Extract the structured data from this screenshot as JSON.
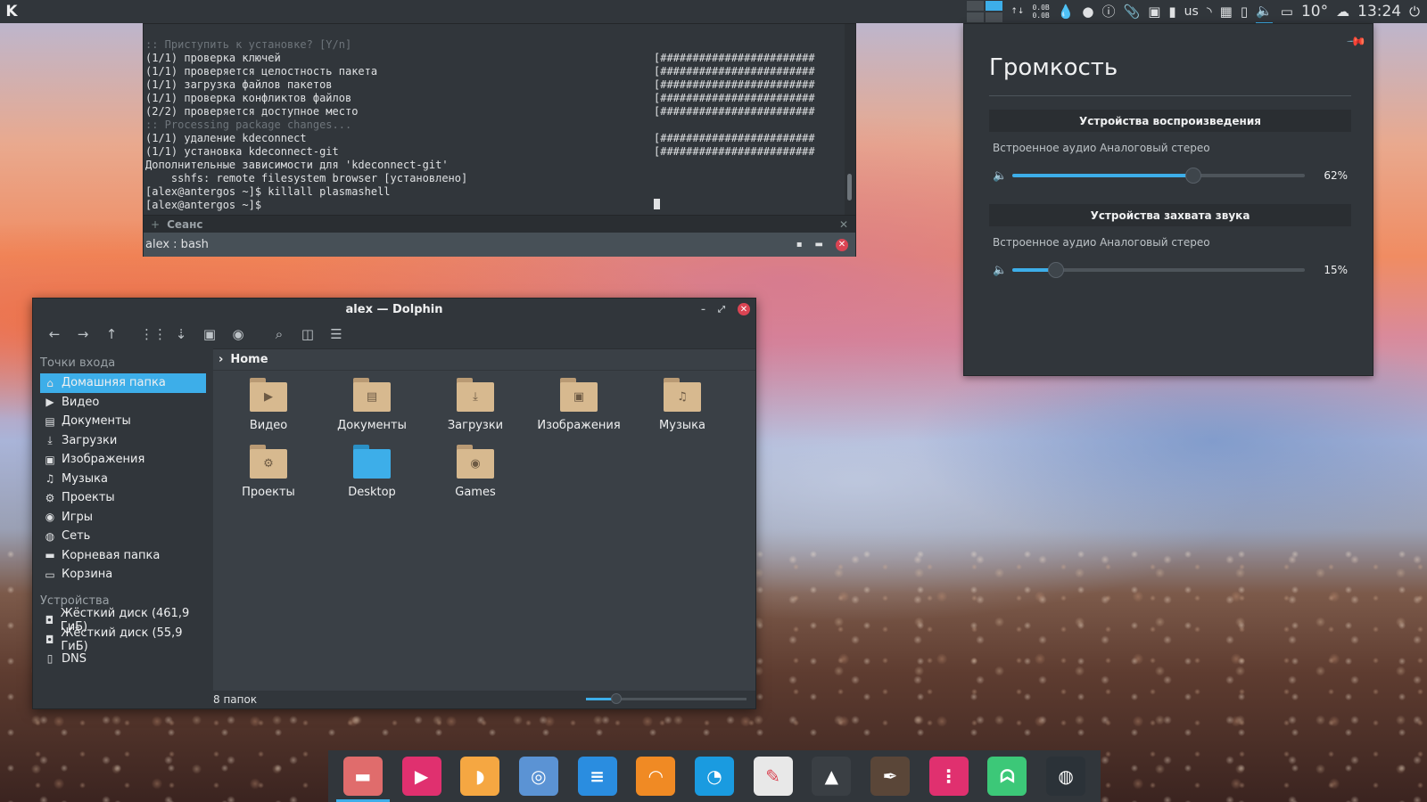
{
  "top_panel": {
    "logo": "K",
    "net_up": "0.0B",
    "net_down": "0.0B",
    "keyboard_layout": "us",
    "weather": "10°",
    "clock": "13:24",
    "icons": [
      "app-launcher-icon",
      "pager-icon",
      "network-speed-icon",
      "drop-icon",
      "record-icon",
      "info-icon",
      "paperclip-icon",
      "vault-icon",
      "usb-icon",
      "keyboard-layout-icon",
      "wifi-icon",
      "network-icon",
      "phone-icon",
      "volume-icon",
      "display-icon",
      "cloud-icon",
      "power-icon"
    ]
  },
  "terminal": {
    "lines": [
      {
        "left": ":: Приступить к установке? [Y/n]",
        "right": "",
        "dim": true
      },
      {
        "left": "(1/1) проверка ключей",
        "right": "[########################"
      },
      {
        "left": "(1/1) проверяется целостность пакета",
        "right": "[########################"
      },
      {
        "left": "(1/1) загрузка файлов пакетов",
        "right": "[########################"
      },
      {
        "left": "(1/1) проверка конфликтов файлов",
        "right": "[########################"
      },
      {
        "left": "(2/2) проверяется доступное место",
        "right": "[########################"
      },
      {
        "left": ":: Processing package changes...",
        "right": "",
        "dim": true
      },
      {
        "left": "(1/1) удаление kdeconnect",
        "right": "[########################"
      },
      {
        "left": "(1/1) установка kdeconnect-git",
        "right": "[########################"
      },
      {
        "left": "Дополнительные зависимости для 'kdeconnect-git'",
        "right": ""
      },
      {
        "left": "    sshfs: remote filesystem browser [установлено]",
        "right": ""
      },
      {
        "left": "[alex@antergos ~]$ killall plasmashell",
        "right": ""
      },
      {
        "left": "[alex@antergos ~]$ ",
        "right": ""
      }
    ],
    "tab_plus": "+",
    "tab_label": "Сеанс",
    "title": "alex : bash"
  },
  "volume": {
    "title": "Громкость",
    "playback_header": "Устройства воспроизведения",
    "playback_device": "Встроенное аудио Аналоговый стерео",
    "playback_level": 62,
    "playback_pct": "62%",
    "capture_header": "Устройства захвата звука",
    "capture_device": "Встроенное аудио Аналоговый стерео",
    "capture_level": 15,
    "capture_pct": "15%"
  },
  "dolphin": {
    "title": "alex — Dolphin",
    "places_header": "Точки входа",
    "places": [
      {
        "label": "Домашняя папка",
        "icon": "home-icon",
        "glyph": "⌂",
        "active": true
      },
      {
        "label": "Видео",
        "icon": "video-icon",
        "glyph": "▶"
      },
      {
        "label": "Документы",
        "icon": "document-icon",
        "glyph": "▤"
      },
      {
        "label": "Загрузки",
        "icon": "download-icon",
        "glyph": "⤓"
      },
      {
        "label": "Изображения",
        "icon": "image-icon",
        "glyph": "▣"
      },
      {
        "label": "Музыка",
        "icon": "music-icon",
        "glyph": "♫"
      },
      {
        "label": "Проекты",
        "icon": "gear-icon",
        "glyph": "⚙"
      },
      {
        "label": "Игры",
        "icon": "gamepad-icon",
        "glyph": "◉"
      },
      {
        "label": "Сеть",
        "icon": "network-icon",
        "glyph": "◍"
      },
      {
        "label": "Корневая папка",
        "icon": "folder-icon",
        "glyph": "▬"
      },
      {
        "label": "Корзина",
        "icon": "trash-icon",
        "glyph": "▭"
      }
    ],
    "devices_header": "Устройства",
    "devices": [
      {
        "label": "Жёсткий диск (461,9 ГиБ)",
        "icon": "harddisk-icon",
        "glyph": "◘"
      },
      {
        "label": "Жёсткий диск (55,9 ГиБ)",
        "icon": "harddisk-icon",
        "glyph": "◘"
      },
      {
        "label": "DNS",
        "icon": "usb-drive-icon",
        "glyph": "▯"
      }
    ],
    "breadcrumb": "Home",
    "folders": [
      {
        "label": "Видео",
        "icon": "folder-video-icon",
        "glyph": "▶"
      },
      {
        "label": "Документы",
        "icon": "folder-documents-icon",
        "glyph": "▤"
      },
      {
        "label": "Загрузки",
        "icon": "folder-downloads-icon",
        "glyph": "⤓"
      },
      {
        "label": "Изображения",
        "icon": "folder-pictures-icon",
        "glyph": "▣"
      },
      {
        "label": "Музыка",
        "icon": "folder-music-icon",
        "glyph": "♫"
      },
      {
        "label": "Проекты",
        "icon": "folder-projects-icon",
        "glyph": "⚙"
      },
      {
        "label": "Desktop",
        "icon": "folder-desktop-icon",
        "glyph": ""
      },
      {
        "label": "Games",
        "icon": "folder-games-icon",
        "glyph": "◉"
      }
    ],
    "status": "8 папок"
  },
  "dock": {
    "items": [
      {
        "icon": "file-manager-icon",
        "color": "#e06c6c",
        "glyph": "▬",
        "active": true
      },
      {
        "icon": "media-player-icon",
        "color": "#e0306f",
        "glyph": "▶"
      },
      {
        "icon": "app-banana-icon",
        "color": "#f5a742",
        "glyph": "◗"
      },
      {
        "icon": "chromium-icon",
        "color": "#5b93d4",
        "glyph": "◎"
      },
      {
        "icon": "messenger-icon",
        "color": "#2a8de0",
        "glyph": "≡"
      },
      {
        "icon": "rss-icon",
        "color": "#f08a24",
        "glyph": "◠"
      },
      {
        "icon": "browser-icon",
        "color": "#1a9be0",
        "glyph": "◔"
      },
      {
        "icon": "text-editor-icon",
        "color": "#e8e8e8",
        "glyph": "✎"
      },
      {
        "icon": "inkscape-icon",
        "color": "#3a3f44",
        "glyph": "▲"
      },
      {
        "icon": "krita-icon",
        "color": "#5a4638",
        "glyph": "✒"
      },
      {
        "icon": "mixer-icon",
        "color": "#e0306f",
        "glyph": "⋮"
      },
      {
        "icon": "ghost-icon",
        "color": "#3cc878",
        "glyph": "ᗣ"
      },
      {
        "icon": "gitkraken-icon",
        "color": "#2b3238",
        "glyph": "◍"
      }
    ]
  }
}
